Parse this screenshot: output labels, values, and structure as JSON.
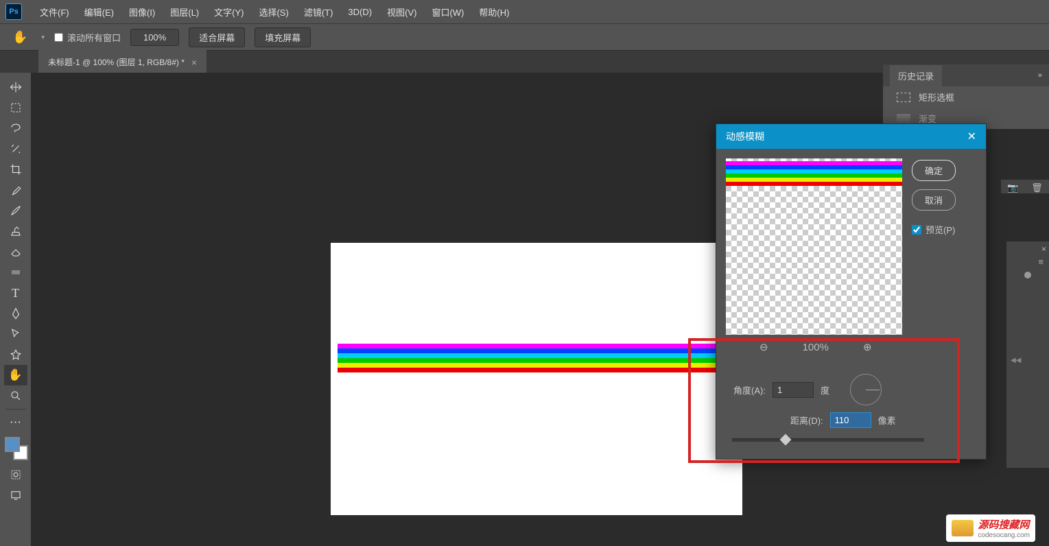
{
  "app": {
    "logo": "Ps"
  },
  "menu": [
    "文件(F)",
    "编辑(E)",
    "图像(I)",
    "图层(L)",
    "文字(Y)",
    "选择(S)",
    "滤镜(T)",
    "3D(D)",
    "视图(V)",
    "窗口(W)",
    "帮助(H)"
  ],
  "options": {
    "scroll_all": "滚动所有窗口",
    "zoom": "100%",
    "fit_screen": "适合屏幕",
    "fill_screen": "填充屏幕"
  },
  "tab": {
    "title": "未标题-1 @ 100% (图层 1, RGB/8#) *"
  },
  "history_panel": {
    "title": "历史记录",
    "items": [
      "矩形选框",
      "渐变"
    ]
  },
  "dialog": {
    "title": "动感模糊",
    "ok": "确定",
    "cancel": "取消",
    "preview_label": "预览(P)",
    "zoom_level": "100%",
    "angle_label": "角度(A):",
    "angle_value": "1",
    "angle_unit": "度",
    "distance_label": "距离(D):",
    "distance_value": "110",
    "distance_unit": "像素"
  },
  "watermark": {
    "main": "源码搜藏网",
    "sub": "codesocang.com"
  },
  "tool_icons": [
    "move",
    "marquee",
    "lasso",
    "wand",
    "crop",
    "eyedropper",
    "brush",
    "stamp",
    "eraser",
    "gradient",
    "type",
    "pen",
    "pointer",
    "shape",
    "hand",
    "zoom"
  ],
  "colors": {
    "accent": "#0b91c7",
    "highlight": "#d42323"
  }
}
